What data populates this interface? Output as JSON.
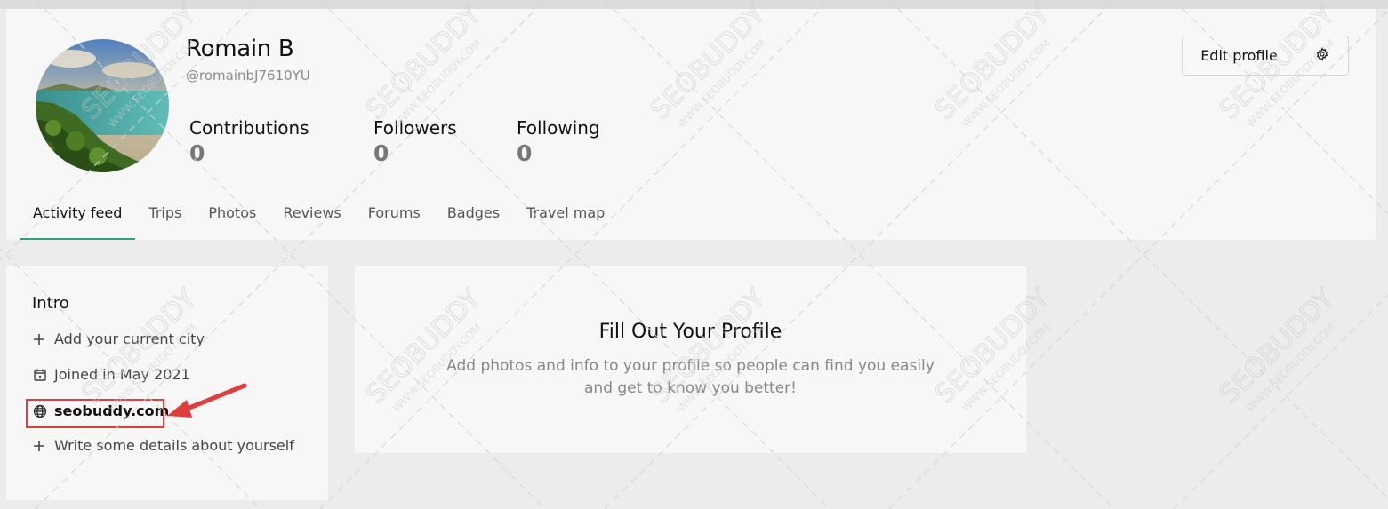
{
  "profile": {
    "name": "Romain B",
    "handle": "@romainbJ7610YU",
    "stats": [
      {
        "label": "Contributions",
        "value": "0"
      },
      {
        "label": "Followers",
        "value": "0"
      },
      {
        "label": "Following",
        "value": "0"
      }
    ]
  },
  "actions": {
    "edit_profile_label": "Edit profile",
    "settings_icon": "gear-icon"
  },
  "tabs": [
    {
      "label": "Activity feed",
      "active": true
    },
    {
      "label": "Trips",
      "active": false
    },
    {
      "label": "Photos",
      "active": false
    },
    {
      "label": "Reviews",
      "active": false
    },
    {
      "label": "Forums",
      "active": false
    },
    {
      "label": "Badges",
      "active": false
    },
    {
      "label": "Travel map",
      "active": false
    }
  ],
  "intro": {
    "title": "Intro",
    "add_city": "Add your current city",
    "joined": "Joined in May 2021",
    "website": "seobuddy.com",
    "write_details": "Write some details about yourself"
  },
  "fill_profile": {
    "title": "Fill Out Your Profile",
    "text": "Add photos and info to your profile so people can find you easily and get to know you better!"
  },
  "watermark": {
    "brand": "SEOBUDDY",
    "url": "WWW.SEOBUDDY.COM"
  },
  "colors": {
    "accent_tab_underline": "#2ea37d",
    "highlight_red": "#e23d3d",
    "card_bg": "#f7f7f7",
    "page_bg": "#ececec"
  }
}
